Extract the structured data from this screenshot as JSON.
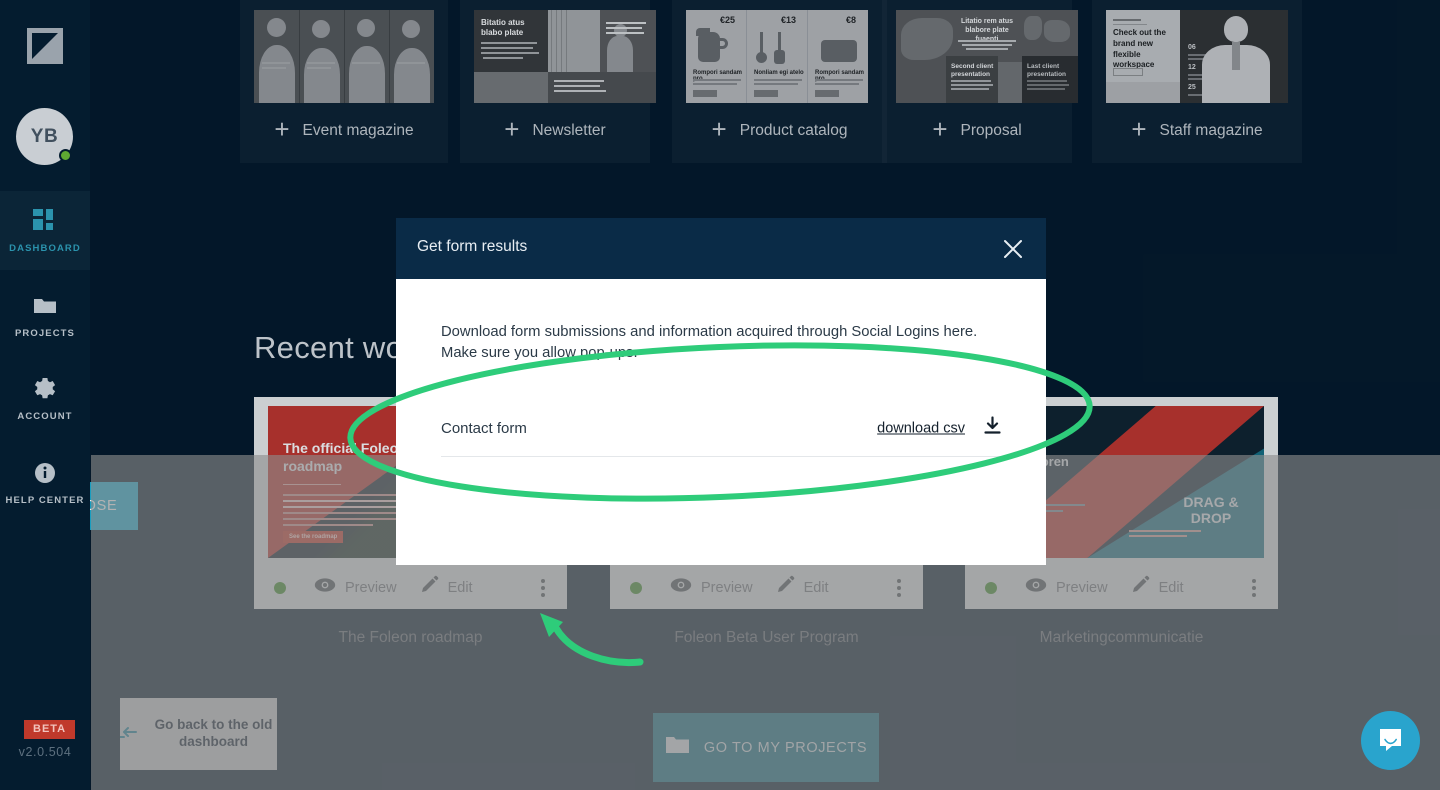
{
  "sidebar": {
    "logo_icon": "foleon-logo-icon",
    "avatar_initials": "YB",
    "items": [
      {
        "label": "DASHBOARD",
        "icon": "dashboard-grid-icon",
        "active": true
      },
      {
        "label": "PROJECTS",
        "icon": "folder-icon",
        "active": false
      },
      {
        "label": "ACCOUNT",
        "icon": "gear-icon",
        "active": false
      },
      {
        "label": "HELP CENTER",
        "icon": "info-circle-icon",
        "active": false
      }
    ],
    "beta_badge": "BETA",
    "version": "v2.0.504"
  },
  "templates": {
    "plus_icon": "plus-icon",
    "items": [
      {
        "label": "Event magazine"
      },
      {
        "label": "Newsletter",
        "thumb_title": "Bitatio atus blabo plate"
      },
      {
        "label": "Product catalog",
        "prices": [
          "€25",
          "€13",
          "€8"
        ],
        "captions": [
          "Rompori sandam pro",
          "Nonliam egi atelo",
          "Rompori sandam pro"
        ]
      },
      {
        "label": "Proposal",
        "thumb_title": "Litatio rem atus blabore plate fuaenti",
        "captions": [
          "Second client presentation",
          "Last client presentation"
        ]
      },
      {
        "label": "Staff magazine",
        "thumb_title": "Check out the brand new flexible workspace",
        "stats": [
          "06",
          "12",
          "25"
        ]
      }
    ]
  },
  "main": {
    "recent_heading": "Recent work",
    "projects": [
      {
        "title": "The Foleon roadmap",
        "status": "online",
        "preview_label": "Preview",
        "edit_label": "Edit",
        "thumb_heading": "The official Foleon roadmap",
        "thumb_cta": "See the roadmap"
      },
      {
        "title": "Foleon Beta User Program",
        "status": "online",
        "preview_label": "Preview",
        "edit_label": "Edit"
      },
      {
        "title": "Marketingcommunicatie",
        "status": "online",
        "preview_label": "Preview",
        "edit_label": "Edit",
        "thumb_heading": "je p als oren",
        "thumb_badge": "DRAG & DROP"
      }
    ],
    "old_dashboard_button": "Go back to the old dashboard",
    "go_to_projects_button": "GO TO MY PROJECTS",
    "chat_icon": "chat-bubble-icon"
  },
  "modal": {
    "title": "Get form results",
    "close_icon": "close-icon",
    "description": "Download form submissions and information acquired through Social Logins here. Make sure you allow pop-ups.",
    "form_name": "Contact form",
    "download_link": "download csv",
    "download_icon": "download-icon",
    "close_button": "CLOSE"
  },
  "annotations": {
    "highlight_ellipse": "green-ellipse-annotation",
    "pointer_arrow": "green-curved-arrow-annotation",
    "color": "#2ecc7a"
  },
  "colors": {
    "sidebar_bg": "#041c2f",
    "page_bg": "#04192c",
    "accent_cyan": "#1aa8cd",
    "modal_header": "#0a2b47",
    "teal_button": "#14697e",
    "beta_red": "#c0392b",
    "annotation_green": "#2ecc7a",
    "status_green": "#3c8a29"
  }
}
